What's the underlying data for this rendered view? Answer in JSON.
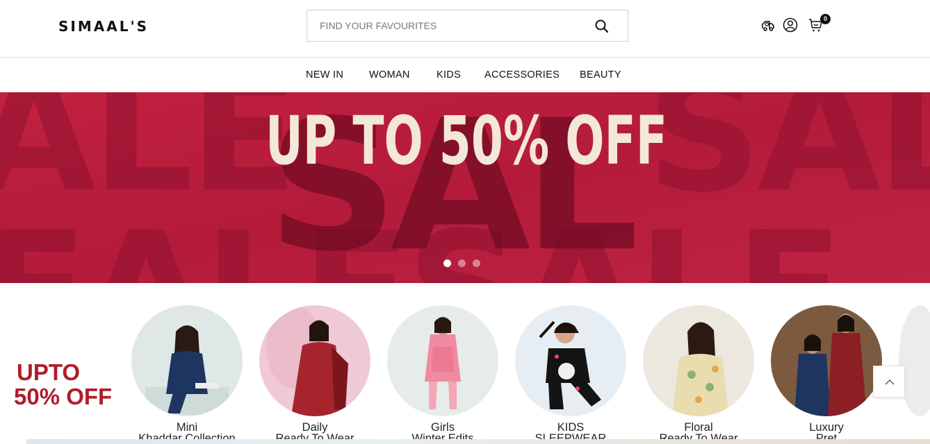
{
  "header": {
    "logo": "SIMAAL'S",
    "search": {
      "placeholder": "FIND YOUR FAVOURITES"
    },
    "icons": [
      "track-order-icon",
      "account-icon",
      "cart-icon"
    ],
    "cart_count": "0"
  },
  "nav": {
    "items": [
      {
        "label": "NEW IN"
      },
      {
        "label": "WOMAN"
      },
      {
        "label": "KIDS"
      },
      {
        "label": "ACCESSORIES"
      },
      {
        "label": "BEAUTY"
      }
    ]
  },
  "hero": {
    "headline": "UP TO 50% OFF",
    "background_text": "SALE SALE SALE",
    "slides_total": 3,
    "active_slide": 1,
    "colors": {
      "background": "#b81e3f",
      "headline": "#f3e7d8"
    }
  },
  "promo": {
    "line1": "UPTO",
    "line2": "50% OFF",
    "color": "#b01c2a"
  },
  "categories": [
    {
      "line1": "Mini",
      "line2": "Khaddar Collection"
    },
    {
      "line1": "Daily",
      "line2": "Ready To Wear"
    },
    {
      "line1": "Girls",
      "line2": "Winter Edits"
    },
    {
      "line1": "KIDS",
      "line2": "SLEEPWEAR"
    },
    {
      "line1": "Floral",
      "line2": "Ready To Wear"
    },
    {
      "line1": "Luxury",
      "line2": "Pret"
    }
  ]
}
